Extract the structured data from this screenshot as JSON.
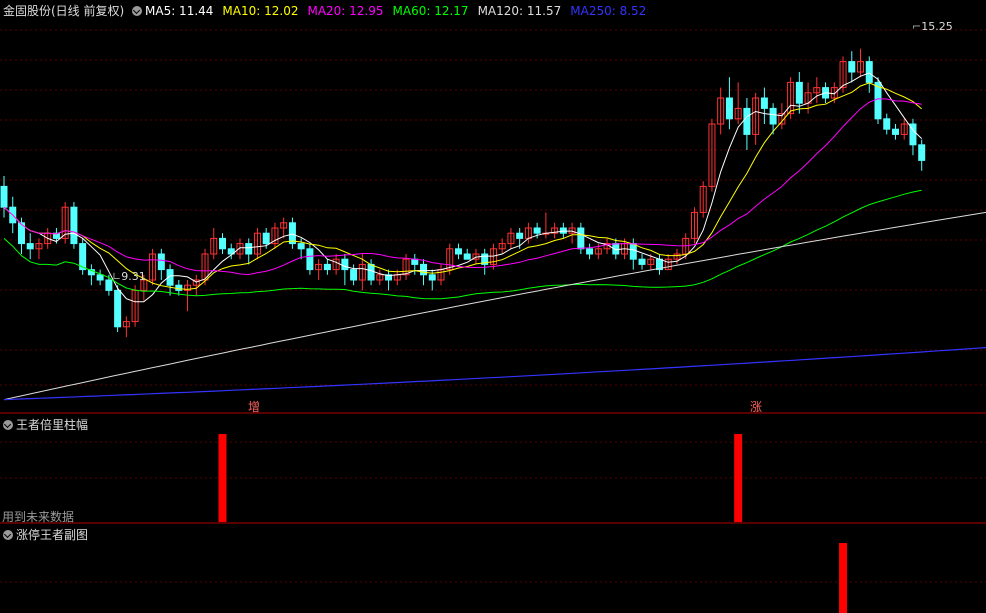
{
  "header": {
    "stock": "金固股份(日线 前复权)",
    "ma": [
      {
        "label": "MA5:",
        "value": "11.44",
        "color": "#ffffff"
      },
      {
        "label": "MA10:",
        "value": "12.02",
        "color": "#ffff00"
      },
      {
        "label": "MA20:",
        "value": "12.95",
        "color": "#ff00ff"
      },
      {
        "label": "MA60:",
        "value": "12.17",
        "color": "#00ff00"
      },
      {
        "label": "MA120:",
        "value": "11.57",
        "color": "#dcdcdc"
      },
      {
        "label": "MA250:",
        "value": "8.52",
        "color": "#3333ff"
      }
    ]
  },
  "annotations": {
    "high": "15.25",
    "low": "9.31",
    "mark1": "增",
    "mark2": "涨"
  },
  "pane2": {
    "title": "王者倍里柱幅",
    "footer": "用到未来数据"
  },
  "pane3": {
    "title": "涨停王者副图"
  },
  "colors": {
    "up": "#ff3232",
    "down": "#54ffff",
    "ma5": "#ffffff",
    "ma10": "#ffff00",
    "ma20": "#ff00ff",
    "ma60": "#00ff00",
    "ma120": "#dcdcdc",
    "ma250": "#3333ff"
  },
  "chart_data": [
    {
      "type": "candlestick",
      "ylim": [
        8.3,
        15.8
      ],
      "candles": [
        [
          12.6,
          12.2,
          12.8,
          12.0
        ],
        [
          12.2,
          11.9,
          12.4,
          11.7
        ],
        [
          11.9,
          11.5,
          12.0,
          11.3
        ],
        [
          11.5,
          11.4,
          11.7,
          11.2
        ],
        [
          11.4,
          11.5,
          11.6,
          11.2
        ],
        [
          11.5,
          11.7,
          11.8,
          11.4
        ],
        [
          11.7,
          11.6,
          11.8,
          11.5
        ],
        [
          11.6,
          12.2,
          12.3,
          11.5
        ],
        [
          12.2,
          11.5,
          12.3,
          11.4
        ],
        [
          11.5,
          11.0,
          11.6,
          10.9
        ],
        [
          11.0,
          10.9,
          11.1,
          10.7
        ],
        [
          10.9,
          10.8,
          11.0,
          10.7
        ],
        [
          10.8,
          10.6,
          10.9,
          10.5
        ],
        [
          10.6,
          9.9,
          10.7,
          9.8
        ],
        [
          9.9,
          10.0,
          10.1,
          9.7
        ],
        [
          10.0,
          10.6,
          10.7,
          9.9
        ],
        [
          10.6,
          10.8,
          10.9,
          10.4
        ],
        [
          10.8,
          11.3,
          11.4,
          10.7
        ],
        [
          11.3,
          11.0,
          11.4,
          10.8
        ],
        [
          11.0,
          10.7,
          11.1,
          10.5
        ],
        [
          10.7,
          10.6,
          10.8,
          10.5
        ],
        [
          10.6,
          10.7,
          10.8,
          10.2
        ],
        [
          10.7,
          10.8,
          10.9,
          10.5
        ],
        [
          10.8,
          11.3,
          11.4,
          10.7
        ],
        [
          11.3,
          11.6,
          11.8,
          11.2
        ],
        [
          11.6,
          11.4,
          11.7,
          11.3
        ],
        [
          11.4,
          11.3,
          11.5,
          11.2
        ],
        [
          11.3,
          11.5,
          11.6,
          11.2
        ],
        [
          11.5,
          11.3,
          11.6,
          11.1
        ],
        [
          11.3,
          11.7,
          11.8,
          11.2
        ],
        [
          11.7,
          11.5,
          11.8,
          11.4
        ],
        [
          11.5,
          11.8,
          11.9,
          11.4
        ],
        [
          11.8,
          11.9,
          12.0,
          11.6
        ],
        [
          11.9,
          11.5,
          12.0,
          11.4
        ],
        [
          11.5,
          11.4,
          11.6,
          11.2
        ],
        [
          11.4,
          11.0,
          11.5,
          10.9
        ],
        [
          11.0,
          11.1,
          11.2,
          10.8
        ],
        [
          11.1,
          11.0,
          11.2,
          10.9
        ],
        [
          11.0,
          11.2,
          11.3,
          10.9
        ],
        [
          11.2,
          11.0,
          11.3,
          10.7
        ],
        [
          11.0,
          10.8,
          11.1,
          10.7
        ],
        [
          10.8,
          11.1,
          11.3,
          10.6
        ],
        [
          11.1,
          10.8,
          11.2,
          10.7
        ],
        [
          10.8,
          10.9,
          11.0,
          10.7
        ],
        [
          10.9,
          10.8,
          11.0,
          10.6
        ],
        [
          10.8,
          10.9,
          11.0,
          10.7
        ],
        [
          10.9,
          11.2,
          11.3,
          10.8
        ],
        [
          11.2,
          11.1,
          11.3,
          10.9
        ],
        [
          11.1,
          10.9,
          11.2,
          10.7
        ],
        [
          10.9,
          10.8,
          11.0,
          10.6
        ],
        [
          10.8,
          11.0,
          11.1,
          10.7
        ],
        [
          11.0,
          11.4,
          11.5,
          10.9
        ],
        [
          11.4,
          11.3,
          11.5,
          11.2
        ],
        [
          11.3,
          11.2,
          11.4,
          11.2
        ],
        [
          11.2,
          11.3,
          11.4,
          11.1
        ],
        [
          11.3,
          11.1,
          11.4,
          10.9
        ],
        [
          11.1,
          11.4,
          11.5,
          11.0
        ],
        [
          11.4,
          11.5,
          11.6,
          11.3
        ],
        [
          11.5,
          11.7,
          11.8,
          11.4
        ],
        [
          11.7,
          11.6,
          11.8,
          11.4
        ],
        [
          11.6,
          11.8,
          11.9,
          11.5
        ],
        [
          11.8,
          11.7,
          11.9,
          11.6
        ],
        [
          11.7,
          11.7,
          12.1,
          11.6
        ],
        [
          11.7,
          11.8,
          11.9,
          11.6
        ],
        [
          11.8,
          11.7,
          11.9,
          11.6
        ],
        [
          11.7,
          11.8,
          11.9,
          11.5
        ],
        [
          11.8,
          11.4,
          11.9,
          11.3
        ],
        [
          11.4,
          11.3,
          11.5,
          11.2
        ],
        [
          11.3,
          11.4,
          11.5,
          11.2
        ],
        [
          11.4,
          11.5,
          11.6,
          11.3
        ],
        [
          11.5,
          11.3,
          11.6,
          11.2
        ],
        [
          11.3,
          11.5,
          11.6,
          11.2
        ],
        [
          11.5,
          11.2,
          11.6,
          11.0
        ],
        [
          11.2,
          11.1,
          11.3,
          11.0
        ],
        [
          11.1,
          11.2,
          11.3,
          11.0
        ],
        [
          11.2,
          11.0,
          11.3,
          10.9
        ],
        [
          11.0,
          11.2,
          11.3,
          11.0
        ],
        [
          11.2,
          11.3,
          11.4,
          11.1
        ],
        [
          11.3,
          11.6,
          11.7,
          11.2
        ],
        [
          11.6,
          12.1,
          12.2,
          11.5
        ],
        [
          12.1,
          12.6,
          12.7,
          12.0
        ],
        [
          12.6,
          13.8,
          13.9,
          12.5
        ],
        [
          13.8,
          14.3,
          14.5,
          13.6
        ],
        [
          14.3,
          13.9,
          14.7,
          13.7
        ],
        [
          13.9,
          14.1,
          14.6,
          13.8
        ],
        [
          14.1,
          13.6,
          14.3,
          13.3
        ],
        [
          13.6,
          14.3,
          14.4,
          13.4
        ],
        [
          14.3,
          14.1,
          14.5,
          13.8
        ],
        [
          14.1,
          13.8,
          14.2,
          13.6
        ],
        [
          13.8,
          14.0,
          14.2,
          13.7
        ],
        [
          14.0,
          14.6,
          14.7,
          13.9
        ],
        [
          14.6,
          14.2,
          14.8,
          14.0
        ],
        [
          14.2,
          14.4,
          14.6,
          14.0
        ],
        [
          14.4,
          14.5,
          14.7,
          14.2
        ],
        [
          14.5,
          14.3,
          14.6,
          14.2
        ],
        [
          14.3,
          14.5,
          14.6,
          14.2
        ],
        [
          14.5,
          15.0,
          15.1,
          14.4
        ],
        [
          15.0,
          14.8,
          15.2,
          14.6
        ],
        [
          14.8,
          15.0,
          15.25,
          14.7
        ],
        [
          15.0,
          14.6,
          15.1,
          14.4
        ],
        [
          14.6,
          13.9,
          14.7,
          13.8
        ],
        [
          13.9,
          13.7,
          14.0,
          13.6
        ],
        [
          13.7,
          13.6,
          13.8,
          13.5
        ],
        [
          13.6,
          13.8,
          13.9,
          13.5
        ],
        [
          13.8,
          13.4,
          13.9,
          13.2
        ],
        [
          13.4,
          13.1,
          13.5,
          12.9
        ]
      ],
      "ma120_endpoints": [
        8.5,
        12.1
      ],
      "ma250_endpoints": [
        8.5,
        9.5
      ]
    },
    {
      "type": "bar",
      "title": "王者倍里柱幅",
      "signal_bars_at_candle": [
        25,
        84
      ],
      "values": [
        1,
        1
      ]
    },
    {
      "type": "bar",
      "title": "涨停王者副图",
      "signal_bars_at_candle": [
        96
      ],
      "values": [
        1
      ]
    }
  ]
}
